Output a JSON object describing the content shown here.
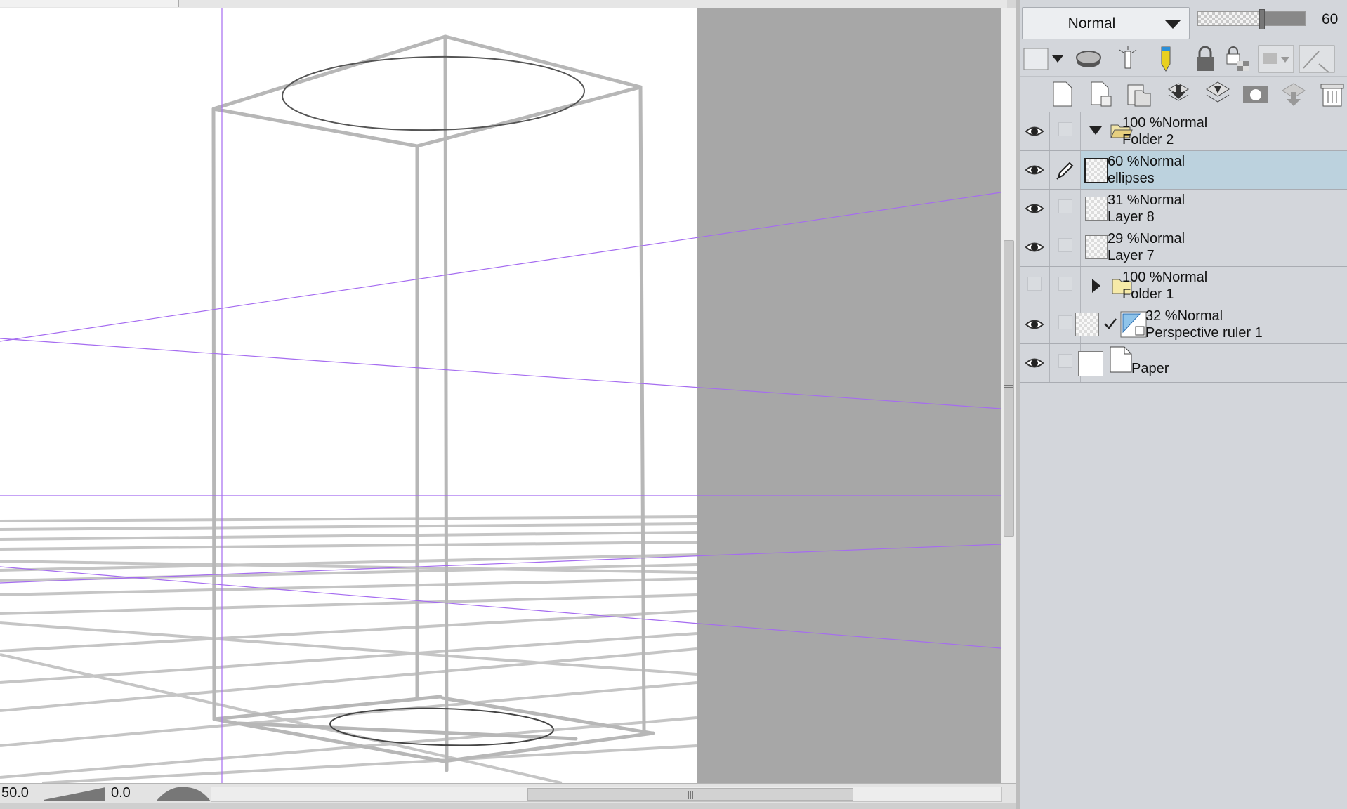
{
  "layer_panel": {
    "blend_mode": "Normal",
    "opacity_value": "60",
    "opacity_fraction": 0.6,
    "layers": [
      {
        "opacity": "100 %",
        "blend": "Normal",
        "name": "Folder 2",
        "kind": "folder-open",
        "visible": true,
        "selected": false
      },
      {
        "opacity": "60 %",
        "blend": "Normal",
        "name": "ellipses",
        "kind": "raster",
        "visible": true,
        "selected": true
      },
      {
        "opacity": "31 %",
        "blend": "Normal",
        "name": "Layer 8",
        "kind": "raster",
        "visible": true,
        "selected": false
      },
      {
        "opacity": "29 %",
        "blend": "Normal",
        "name": "Layer 7",
        "kind": "raster",
        "visible": true,
        "selected": false
      },
      {
        "opacity": "100 %",
        "blend": "Normal",
        "name": "Folder 1",
        "kind": "folder-closed",
        "visible": false,
        "selected": false
      },
      {
        "opacity": "32 %",
        "blend": "Normal",
        "name": "Perspective ruler 1",
        "kind": "ruler",
        "visible": true,
        "selected": false
      },
      {
        "opacity": "",
        "blend": "",
        "name": "Paper",
        "kind": "paper",
        "visible": true,
        "selected": false
      }
    ]
  },
  "status": {
    "zoom": "50.0",
    "rotation": "0.0"
  },
  "icons": {
    "visibility": "eye-icon",
    "edit": "pen-icon",
    "folder": "folder-icon"
  },
  "colors": {
    "canvas_bg": "#a7a7a7",
    "paper": "#ffffff",
    "guide": "#9a66e6",
    "selected_row": "#bcd2de"
  }
}
